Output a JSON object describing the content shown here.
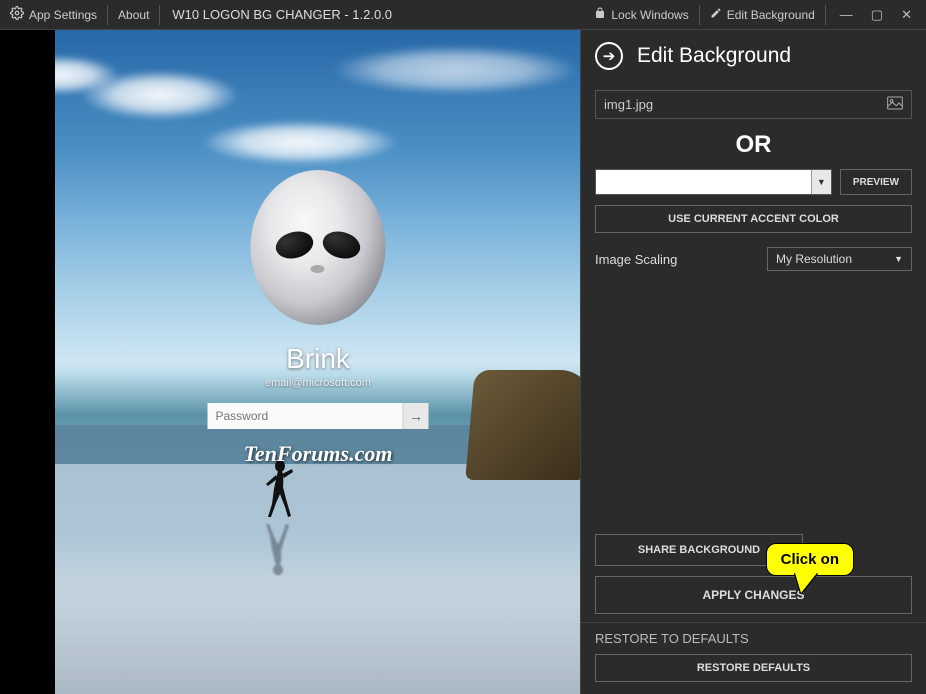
{
  "titlebar": {
    "app_settings": "App Settings",
    "about": "About",
    "title": "W10 LOGON BG CHANGER - 1.2.0.0",
    "lock_windows": "Lock Windows",
    "edit_background": "Edit Background"
  },
  "login": {
    "username": "Brink",
    "email": "email@microsoft.com",
    "password_placeholder": "Password",
    "watermark": "TenForums.com"
  },
  "panel": {
    "title": "Edit Background",
    "image_path": "img1.jpg",
    "or_label": "OR",
    "preview_btn": "PREVIEW",
    "accent_btn": "USE CURRENT ACCENT COLOR",
    "scaling_label": "Image Scaling",
    "scaling_value": "My Resolution",
    "share_btn": "SHARE BACKGROUND",
    "apply_btn": "APPLY CHANGES",
    "restore_title": "RESTORE TO DEFAULTS",
    "restore_btn": "RESTORE DEFAULTS"
  },
  "callout": "Click on"
}
